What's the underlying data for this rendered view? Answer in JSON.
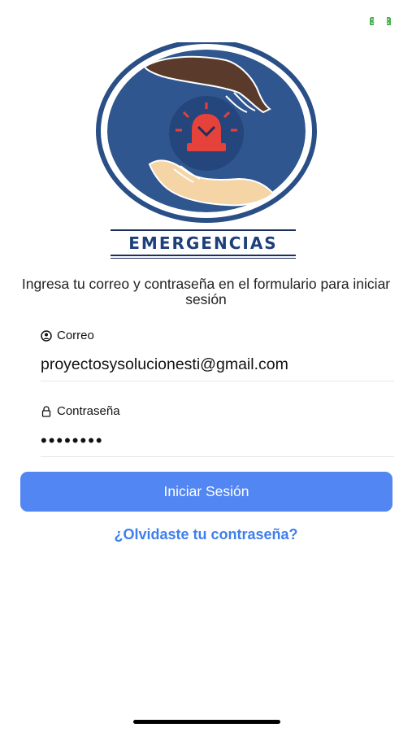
{
  "brand": {
    "name": "EMERGENCIAS"
  },
  "intro": {
    "text": "Ingresa tu correo y contraseña en el formulario para iniciar sesión"
  },
  "form": {
    "email_label": "Correo",
    "email_value": "proyectosysolucionesti@gmail.com",
    "password_label": "Contraseña",
    "password_value": "••••••••"
  },
  "actions": {
    "login_label": "Iniciar Sesión",
    "forgot_label": "¿Olvidaste tu contraseña?"
  },
  "icons": {
    "status": "expand-arrows-icon",
    "logo": "emergency-siren-hands-logo",
    "email": "user-circle-icon",
    "password": "lock-icon"
  },
  "colors": {
    "primary": "#5286f3",
    "link": "#3e7fee",
    "brand": "#1d3f7a",
    "status": "#4caf50"
  }
}
